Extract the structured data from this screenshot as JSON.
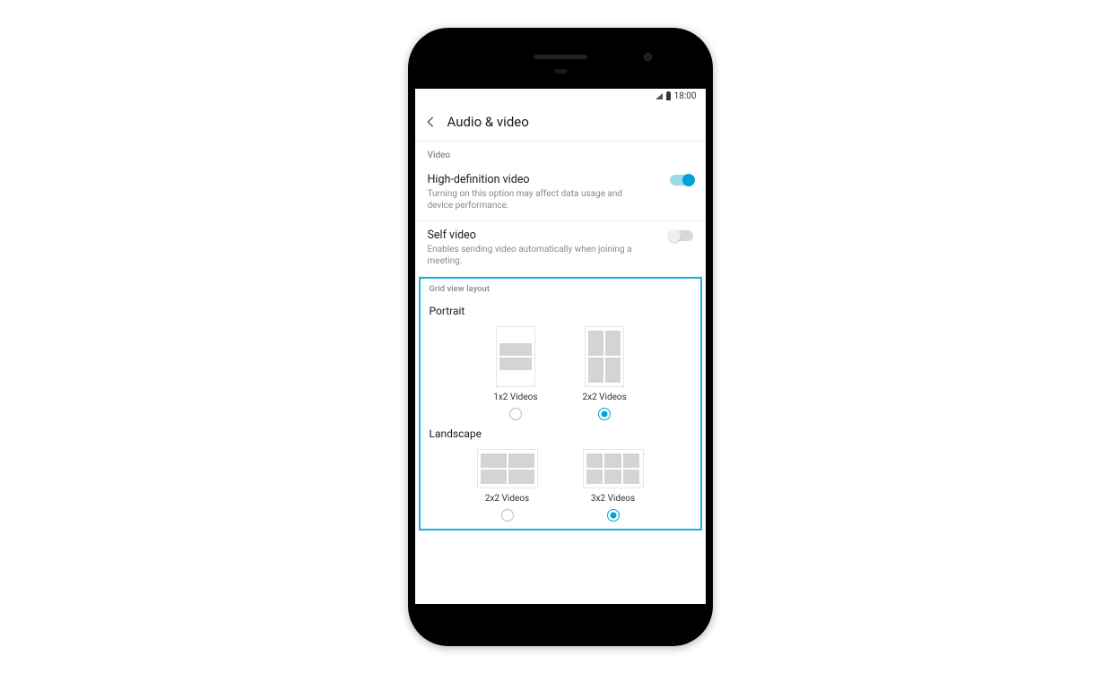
{
  "status": {
    "time": "18:00"
  },
  "header": {
    "title": "Audio & video"
  },
  "video": {
    "section_label": "Video",
    "hd": {
      "title": "High-definition video",
      "desc": "Turning on this option may affect data usage and device performance.",
      "enabled": true
    },
    "self": {
      "title": "Self video",
      "desc": "Enables sending video automatically when joining a meeting.",
      "enabled": false
    }
  },
  "grid": {
    "section_label": "Grid view layout",
    "portrait": {
      "label": "Portrait",
      "options": [
        {
          "label": "1x2 Videos",
          "selected": false
        },
        {
          "label": "2x2 Videos",
          "selected": true
        }
      ]
    },
    "landscape": {
      "label": "Landscape",
      "options": [
        {
          "label": "2x2 Videos",
          "selected": false
        },
        {
          "label": "3x2 Videos",
          "selected": true
        }
      ]
    }
  }
}
